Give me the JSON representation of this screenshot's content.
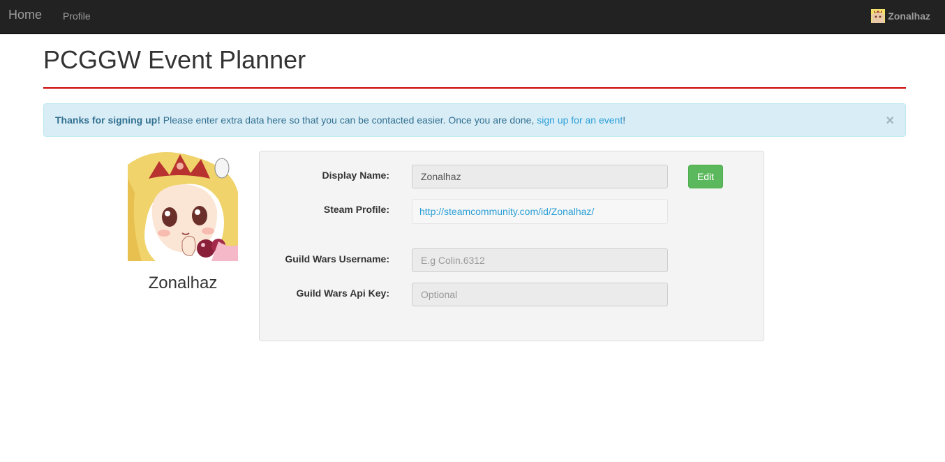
{
  "navbar": {
    "brand": "Home",
    "links": [
      {
        "label": "Profile"
      }
    ],
    "user": {
      "name": "Zonalhaz"
    }
  },
  "header": {
    "title": "PCGGW Event Planner",
    "rule_color": "#cc0000"
  },
  "alert": {
    "strong": "Thanks for signing up!",
    "text": " Please enter extra data here so that you can be contacted easier. Once you are done, ",
    "link": "sign up for an event",
    "suffix": "!",
    "close": "×"
  },
  "profile": {
    "name": "Zonalhaz"
  },
  "form": {
    "display_name": {
      "label": "Display Name:",
      "value": "Zonalhaz",
      "edit_label": "Edit"
    },
    "steam_profile": {
      "label": "Steam Profile:",
      "value": "http://steamcommunity.com/id/Zonalhaz/"
    },
    "gw_username": {
      "label": "Guild Wars Username:",
      "value": "",
      "placeholder": "E.g Colin.6312"
    },
    "gw_api_key": {
      "label": "Guild Wars Api Key:",
      "value": "",
      "placeholder": "Optional"
    }
  },
  "colors": {
    "navbar_bg": "#222222",
    "accent_link": "#2a9fd6",
    "alert_bg": "#d9edf7",
    "success": "#5cb85c"
  }
}
